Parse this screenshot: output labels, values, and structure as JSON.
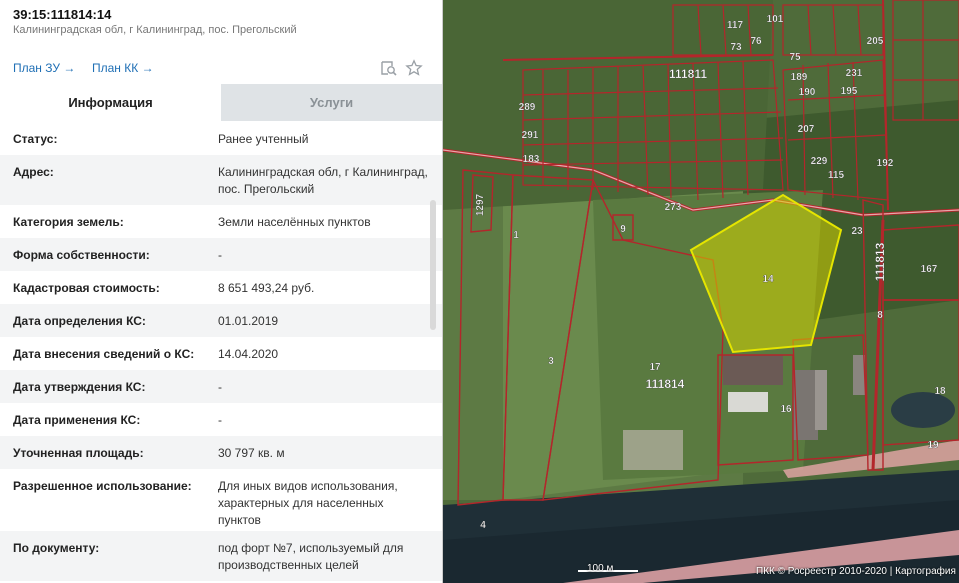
{
  "header": {
    "title": "39:15:111814:14",
    "subtitle": "Калининградская обл, г Калининград, пос. Прегольский",
    "plan_zu": "План ЗУ →",
    "plan_kk": "План КК →"
  },
  "tabs": [
    "Информация",
    "Услуги"
  ],
  "rows": [
    {
      "k": "Статус:",
      "v": "Ранее учтенный"
    },
    {
      "k": "Адрес:",
      "v": "Калининградская обл, г Калининград, пос. Прегольский"
    },
    {
      "k": "Категория земель:",
      "v": "Земли населённых пунктов"
    },
    {
      "k": "Форма собственности:",
      "v": "-"
    },
    {
      "k": "Кадастровая стоимость:",
      "v": "8 651 493,24 руб."
    },
    {
      "k": "Дата определения КС:",
      "v": "01.01.2019"
    },
    {
      "k": "Дата внесения сведений о КС:",
      "v": "14.04.2020"
    },
    {
      "k": "Дата утверждения КС:",
      "v": "-"
    },
    {
      "k": "Дата применения КС:",
      "v": "-"
    },
    {
      "k": "Уточненная площадь:",
      "v": "30 797 кв. м"
    },
    {
      "k": "Разрешенное использование:",
      "v": "Для иных видов использования, характерных для населенных пунктов"
    },
    {
      "k": "По документу:",
      "v": "под форт №7, используемый для производственных целей"
    }
  ],
  "map": {
    "selected_parcel_label": "14",
    "quarter_labels": [
      "111811",
      "111814",
      "111813"
    ],
    "parcel_labels": [
      "1",
      "3",
      "4",
      "9",
      "16",
      "17",
      "18",
      "19",
      "23",
      "8",
      "167",
      "192",
      "207",
      "229",
      "115",
      "1297",
      "273",
      "117",
      "101",
      "205",
      "231",
      "195",
      "189",
      "190",
      "75",
      "73",
      "76",
      "289",
      "291",
      "183"
    ],
    "scale_label": "100 м",
    "footer": "ПКК © Росреестр 2010-2020 | Картография"
  },
  "colors": {
    "link": "#1f6fb5",
    "selected_fill": "#d4d400",
    "boundary": "#b3262b"
  }
}
